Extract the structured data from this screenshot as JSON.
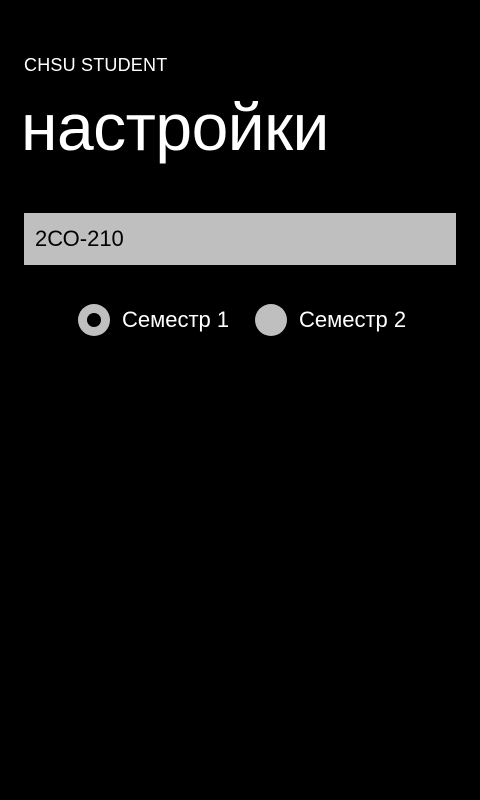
{
  "app": {
    "title": "CHSU STUDENT"
  },
  "page": {
    "title": "настройки"
  },
  "group_input": {
    "value": "2СО-210"
  },
  "semester": {
    "options": [
      {
        "label": "Семестр 1",
        "checked": true
      },
      {
        "label": "Семестр 2",
        "checked": false
      }
    ]
  },
  "colors": {
    "background": "#000000",
    "foreground": "#ffffff",
    "control": "#bfbfbf",
    "control_text": "#000000"
  }
}
